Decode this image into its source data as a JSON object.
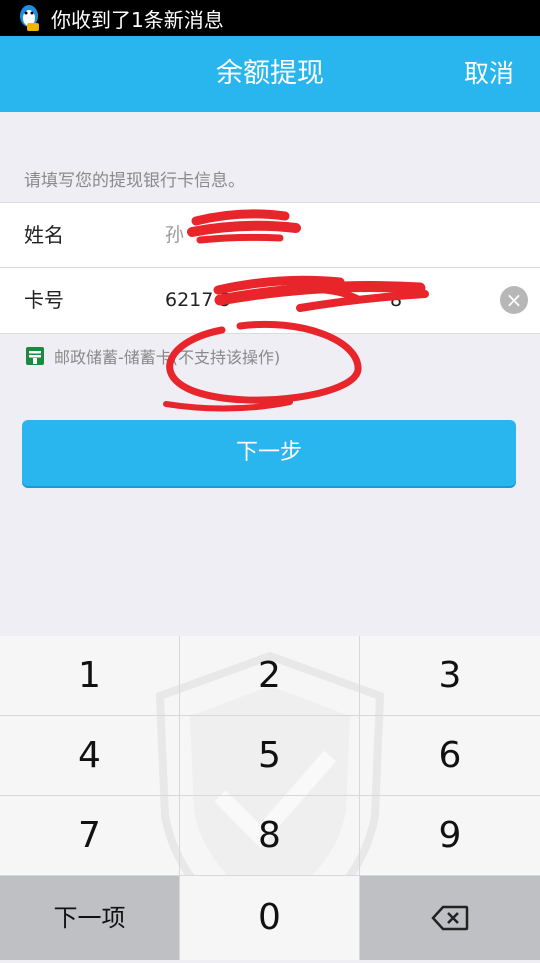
{
  "status_bar": {
    "notification": "你收到了1条新消息"
  },
  "nav": {
    "title": "余额提现",
    "cancel": "取消"
  },
  "hint": "请填写您的提现银行卡信息。",
  "form": {
    "name_label": "姓名",
    "name_value": "孙",
    "card_label": "卡号",
    "card_value": "6217 9",
    "card_value_tail": "8"
  },
  "bank": {
    "name": "邮政储蓄-储蓄卡(不支持该操作)"
  },
  "next_button": "下一步",
  "keypad": {
    "keys": [
      "1",
      "2",
      "3",
      "4",
      "5",
      "6",
      "7",
      "8",
      "9"
    ],
    "next_field": "下一项",
    "zero": "0",
    "backspace_icon": "backspace-icon"
  },
  "colors": {
    "accent": "#29b6ef",
    "scribble": "#e8252b"
  }
}
